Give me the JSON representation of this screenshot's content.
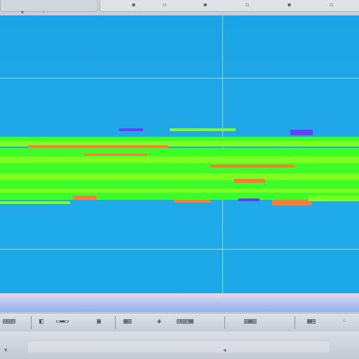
{
  "colors": {
    "plot_background": "#1ea6e8",
    "signal_green": "#3cff2a",
    "signal_lime": "#7dff1f",
    "signal_orange": "#ff7a3a",
    "signal_purple": "#6a3cff",
    "grid": "#ffffff"
  },
  "toolbar": {
    "items": [
      {
        "icon": "waveform-icon",
        "text": ""
      },
      {
        "icon": "view-icon",
        "text": ""
      },
      {
        "icon": "ruler-icon",
        "text": ""
      },
      {
        "icon": "frame-icon",
        "text": ""
      },
      {
        "icon": "measure-icon",
        "text": ""
      },
      {
        "icon": "counter-icon",
        "text": ""
      },
      {
        "icon": "menu-icon",
        "text": ""
      }
    ]
  }
}
